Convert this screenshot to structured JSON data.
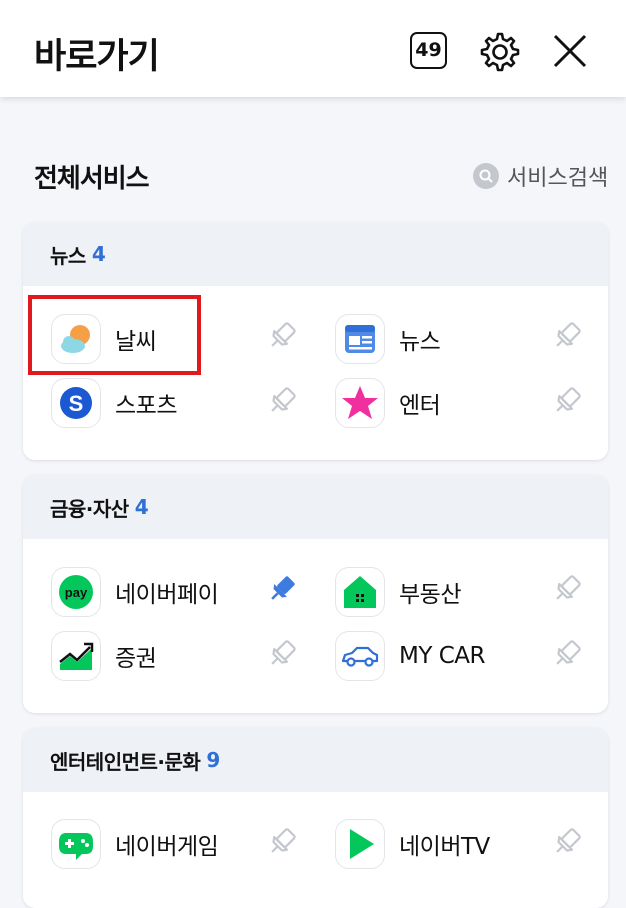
{
  "header": {
    "title": "바로가기",
    "tab_count": "49",
    "settings_icon": "gear-icon",
    "close_icon": "close-icon"
  },
  "main": {
    "section_title": "전체서비스",
    "search_label": "서비스검색",
    "categories": [
      {
        "name": "뉴스",
        "count": "4",
        "items": [
          {
            "label": "날씨",
            "icon": "weather-icon",
            "pinned": false
          },
          {
            "label": "뉴스",
            "icon": "news-icon",
            "pinned": false
          },
          {
            "label": "스포츠",
            "icon": "sports-icon",
            "pinned": false
          },
          {
            "label": "엔터",
            "icon": "entertainment-star-icon",
            "pinned": false
          }
        ]
      },
      {
        "name": "금융·자산",
        "count": "4",
        "items": [
          {
            "label": "네이버페이",
            "icon": "naver-pay-icon",
            "pinned": true
          },
          {
            "label": "부동산",
            "icon": "real-estate-icon",
            "pinned": false
          },
          {
            "label": "증권",
            "icon": "stock-chart-icon",
            "pinned": false
          },
          {
            "label": "MY CAR",
            "icon": "car-icon",
            "pinned": false
          }
        ]
      },
      {
        "name": "엔터테인먼트·문화",
        "count": "9",
        "items": [
          {
            "label": "네이버게임",
            "icon": "gamepad-icon",
            "pinned": false
          },
          {
            "label": "네이버TV",
            "icon": "play-icon",
            "pinned": false
          }
        ]
      }
    ]
  },
  "colors": {
    "accent_blue": "#2f6fd6",
    "highlight_red": "#e0191e",
    "naver_green": "#03c75a",
    "pin_active": "#3d7bde",
    "pin_inactive": "#c4c8ce"
  }
}
